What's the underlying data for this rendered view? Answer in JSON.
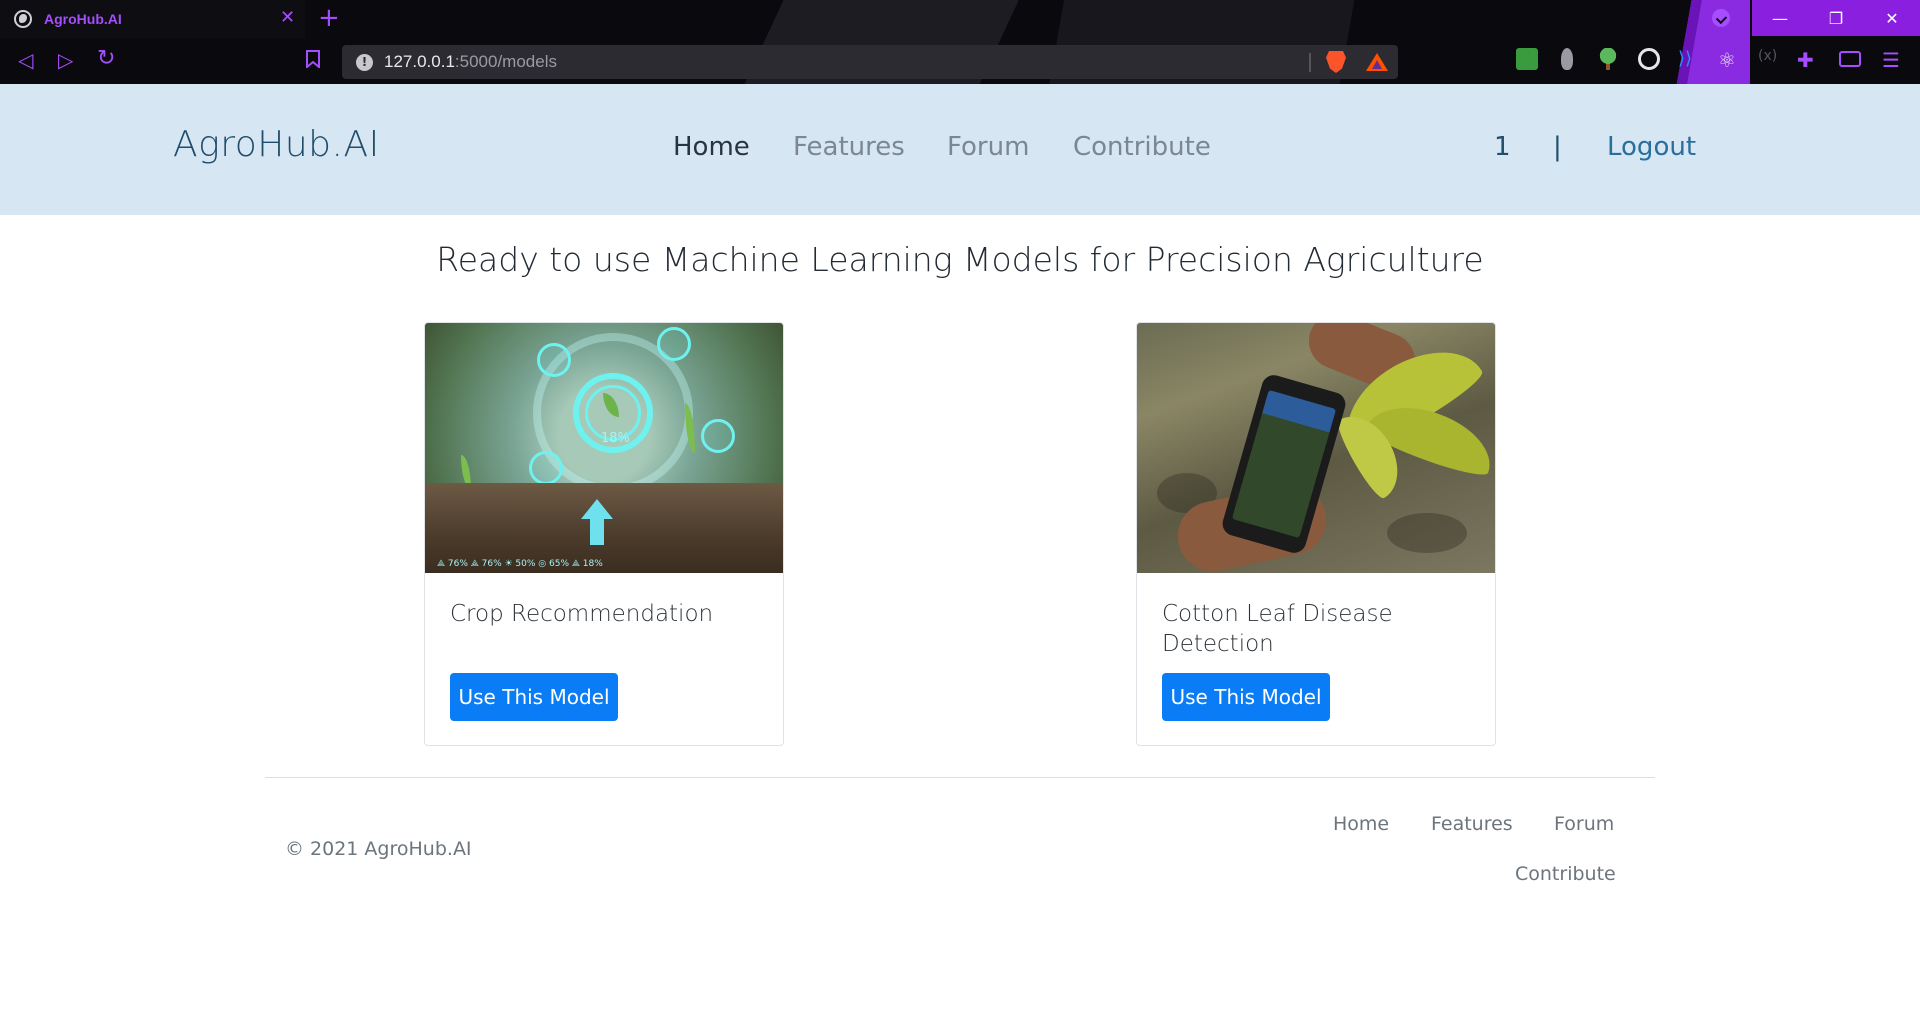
{
  "browser": {
    "tab_title": "AgroHub.AI",
    "tab_close": "✕",
    "new_tab": "+",
    "url_host": "127.0.0.1",
    "url_rest": ":5000/models",
    "info_glyph": "!",
    "minimize": "—",
    "restore": "❐",
    "close": "✕",
    "back": "◁",
    "forward": "▷",
    "reload": "↻",
    "bookmark": "🔖",
    "menu": "☰",
    "accent_color": "#a64dff"
  },
  "site": {
    "brand": "AgroHub.AI",
    "nav": [
      "Home",
      "Features",
      "Forum",
      "Contribute"
    ],
    "user_id": "1",
    "separator": "|",
    "logout": "Logout"
  },
  "main": {
    "title": "Ready to use Machine Learning Models for Precision Agriculture",
    "cards": [
      {
        "title": "Crop Recommendation",
        "button": "Use This Model",
        "image": "crop-sensor-image"
      },
      {
        "title": "Cotton Leaf Disease Detection",
        "button": "Use This Model",
        "image": "cotton-leaf-phone-image"
      }
    ],
    "crop_image_stats": "⟁ 76%   ⟁ 76%   ☀ 50%   ◎ 65%   ⟁ 18%",
    "crop_image_center": "18%"
  },
  "footer": {
    "copyright": "© 2021 AgroHub.AI",
    "links": [
      "Home",
      "Features",
      "Forum",
      "Contribute"
    ]
  },
  "colors": {
    "header_bg": "#d7e6f3",
    "button_bg": "#0a7cf5",
    "brand_color": "#1f4d6b"
  }
}
